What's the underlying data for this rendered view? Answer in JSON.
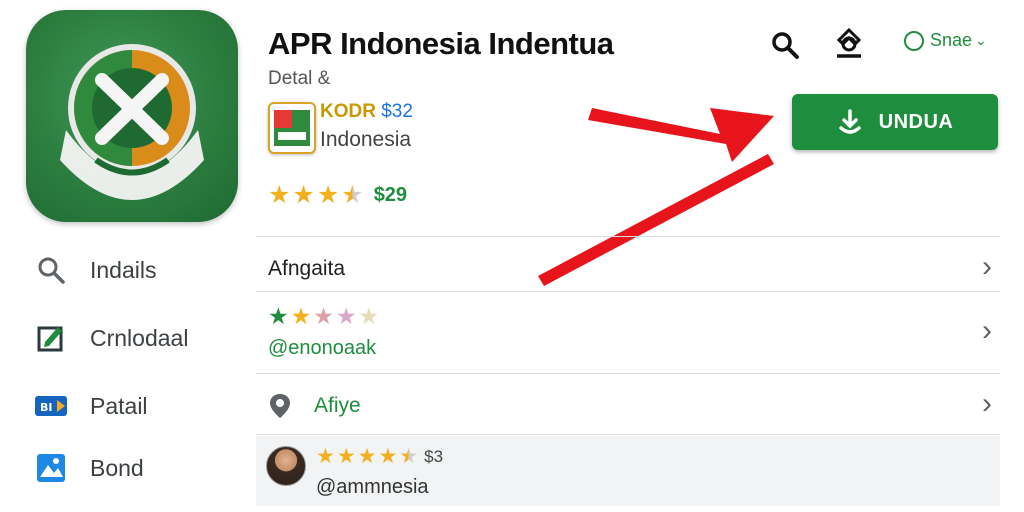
{
  "app": {
    "title": "APR Indonesia Indentua",
    "subtitle": "Detal &",
    "developer_code": "KODR",
    "developer_price": "$32",
    "developer_country": "Indonesia",
    "rating_count": "$29",
    "rating_stars": 3.5
  },
  "header": {
    "search_icon": "search-icon",
    "share_icon": "share-icon",
    "language_label": "Snae"
  },
  "install": {
    "label": "UNDUA",
    "icon": "download-icon"
  },
  "sidebar": {
    "items": [
      {
        "label": "Indails",
        "icon": "search-icon"
      },
      {
        "label": "Crnlodaal",
        "icon": "edit-icon"
      },
      {
        "label": "Patail",
        "icon": "bank-icon"
      },
      {
        "label": "Bond",
        "icon": "image-icon"
      }
    ]
  },
  "rows": {
    "angulata": {
      "label": "Afngaita"
    },
    "review1": {
      "handle": "@enonoaak",
      "stars": 2.5
    },
    "location": {
      "label": "Afiye"
    },
    "review2": {
      "handle": "@ammnesia",
      "count": "$3",
      "stars": 4.5
    }
  },
  "colors": {
    "accent": "#1e8e3e",
    "star": "#f2b01e",
    "arrow": "#e8141b"
  }
}
